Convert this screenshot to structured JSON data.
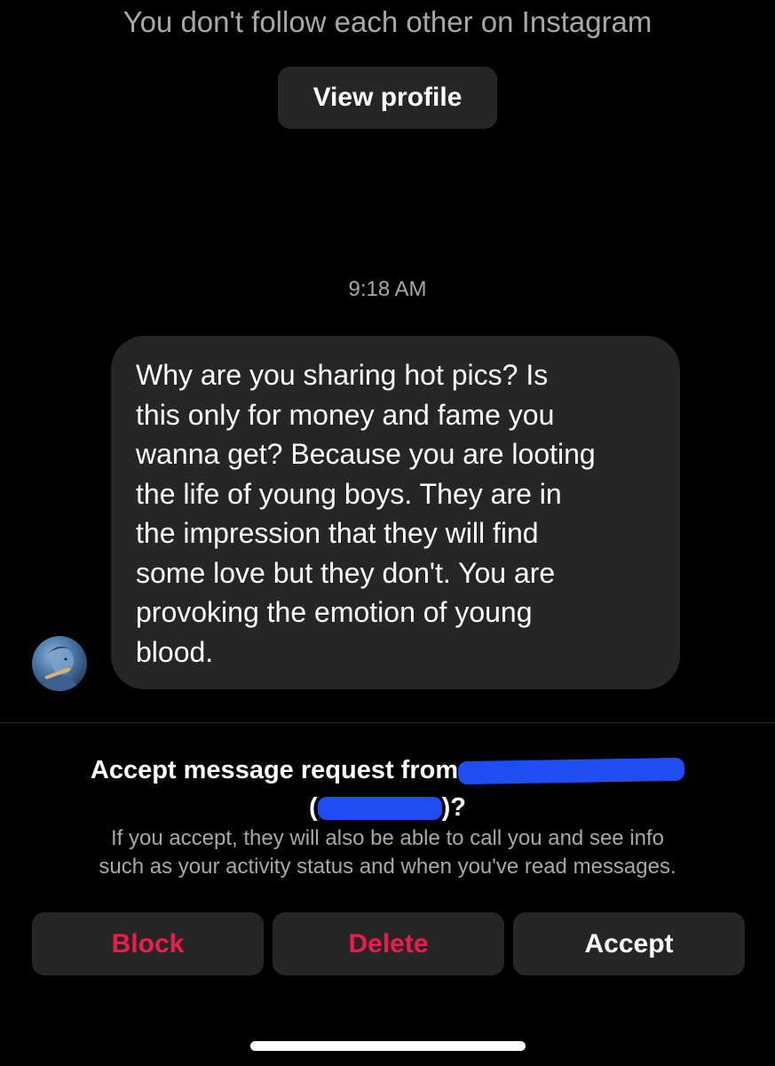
{
  "header": {
    "follow_note": "You don't follow each other on Instagram",
    "view_profile_label": "View profile"
  },
  "thread": {
    "timestamp": "9:18 AM",
    "message_lines": [
      "Why are you sharing hot pics? Is",
      "this only for money and fame you",
      "wanna get? Because you are looting",
      "the life of young boys. They are in",
      "the impression that they will find",
      "some love but they don't. You are",
      "provoking the emotion of young",
      "blood."
    ]
  },
  "request": {
    "title_prefix": "Accept message request from",
    "title_open_paren": "(",
    "title_suffix": ")?",
    "info_line1": "If you accept, they will also be able to call you and see info",
    "info_line2": "such as your activity status and when you've read messages."
  },
  "actions": {
    "block_label": "Block",
    "delete_label": "Delete",
    "accept_label": "Accept"
  },
  "colors": {
    "background": "#000000",
    "surface": "#262626",
    "secondary_text": "#a8a8a8",
    "destructive": "#ed1c4d",
    "redaction": "#1f4df2"
  },
  "icons": {
    "sender_avatar": "avatar"
  }
}
